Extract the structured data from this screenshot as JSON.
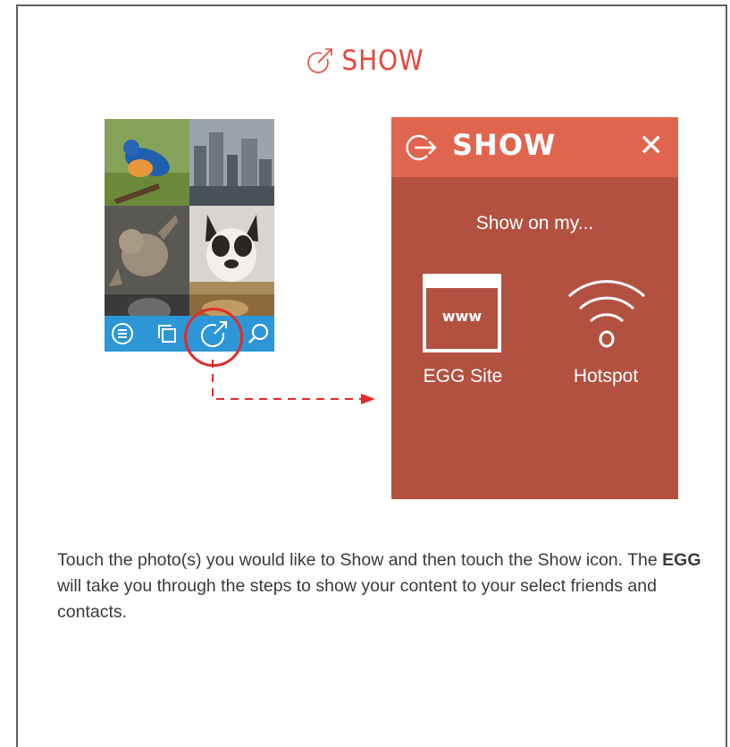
{
  "page_title": "SHOW",
  "show_panel": {
    "title": "SHOW",
    "close_glyph": "✕",
    "prompt": "Show on my...",
    "options": [
      {
        "label": "EGG Site",
        "icon_text": "www",
        "icon": "www-browser-icon"
      },
      {
        "label": "Hotspot",
        "icon": "wifi-hotspot-icon"
      }
    ]
  },
  "phone": {
    "toolbar_icons": [
      "menu-icon",
      "copy-icon",
      "show-share-icon",
      "search-icon"
    ]
  },
  "description": {
    "part1": "Touch the photo(s) you would like to Show and then touch the Show icon. The ",
    "bold": "EGG",
    "part2": " will take you through the steps to show your content to your select friends and contacts."
  },
  "colors": {
    "accent_red": "#e4473a",
    "panel_bg": "#b35140",
    "panel_header": "#e0654e",
    "toolbar_blue": "#2c96d6",
    "highlight_red": "#e02c2c"
  }
}
